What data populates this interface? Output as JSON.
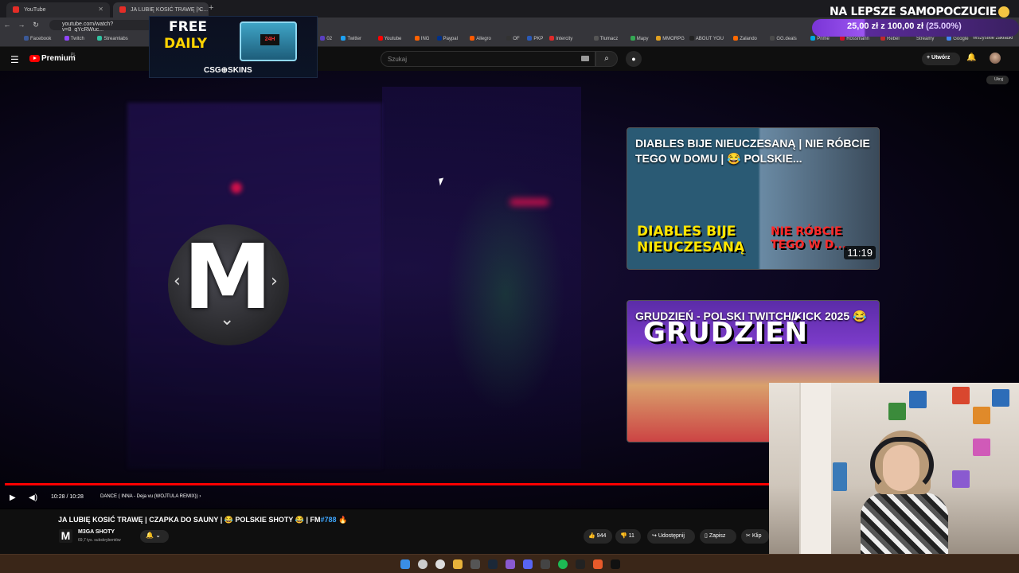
{
  "browser": {
    "tabs": [
      {
        "label": "YouTube"
      },
      {
        "label": "JA LUBIĘ KOSIĆ TRAWĘ | C..."
      }
    ],
    "url": "youtube.com/watch?v=8_qYcRWuc...",
    "bookmarks": [
      "Facebook",
      "Twitch",
      "Streamlabs",
      "02",
      "Twitter",
      "Youtube",
      "ING",
      "Paypal",
      "Allegro",
      "OF",
      "PKP",
      "Intercity",
      "Tłumacz",
      "Mapy",
      "MMORPG",
      "ABOUT YOU",
      "Zalando",
      "GG.deals",
      "Prime",
      "Rossmann",
      "Rebel",
      "Streamy",
      "Google"
    ],
    "bookmarks_more": "Wszystkie zakładki"
  },
  "youtube": {
    "logo_text": "Premium",
    "logo_sup": "PL",
    "search_placeholder": "Szukaj",
    "create_label": "Utwórz",
    "hide_label": "Ukryj"
  },
  "stream_ad": {
    "line1": "FREE",
    "line2": "DAILY",
    "brand": "CSG⊕SKINS",
    "chest_label": "24H"
  },
  "donation_goal": {
    "title": "NA LEPSZE SAMOPOCZUCIE",
    "current": "25,00 zł",
    "sep": "z",
    "target": "100,00 zł",
    "percent_text": "(25.00%)",
    "progress": 0.25
  },
  "video": {
    "overlay_letter": "M",
    "time": "10:28 / 10:28",
    "chapter": "DANCE ( INNA - Deja vu (WOJTULA REMIX)) ›",
    "progress": 1.0
  },
  "end_cards": [
    {
      "title": "DIABLES BIJE NIEUCZESANĄ | NIE RÓBCIE TEGO W DOMU | 😂 POLSKIE...",
      "thumb_left": "DIABLES BIJE NIEUCZESANĄ",
      "thumb_right": "NIE RÓBCIE TEGO W D...",
      "duration": "11:19"
    },
    {
      "title": "GRUDZIEŃ - POLSKI TWITCH/KICK 2025 😂",
      "thumb_big": "GRUDZIEŃ"
    }
  ],
  "below_video": {
    "title": "JA LUBIĘ KOSIĆ TRAWĘ | CZAPKA DO SAUNY | 😂 POLSKIE SHOTY 😂 | FM",
    "title_hash": "#788",
    "title_emoji": "🔥",
    "channel_name": "M3GA SHOTY",
    "channel_subs": "69,7 tys. subskrybentów",
    "likes": "944",
    "dislikes": "11",
    "share_label": "Udostępnij",
    "save_label": "Zapisz",
    "clip_label": "Klip"
  },
  "colors": {
    "accent_red": "#ff0000",
    "goal_purple": "#9b55f0",
    "link_blue": "#3ea6ff"
  }
}
